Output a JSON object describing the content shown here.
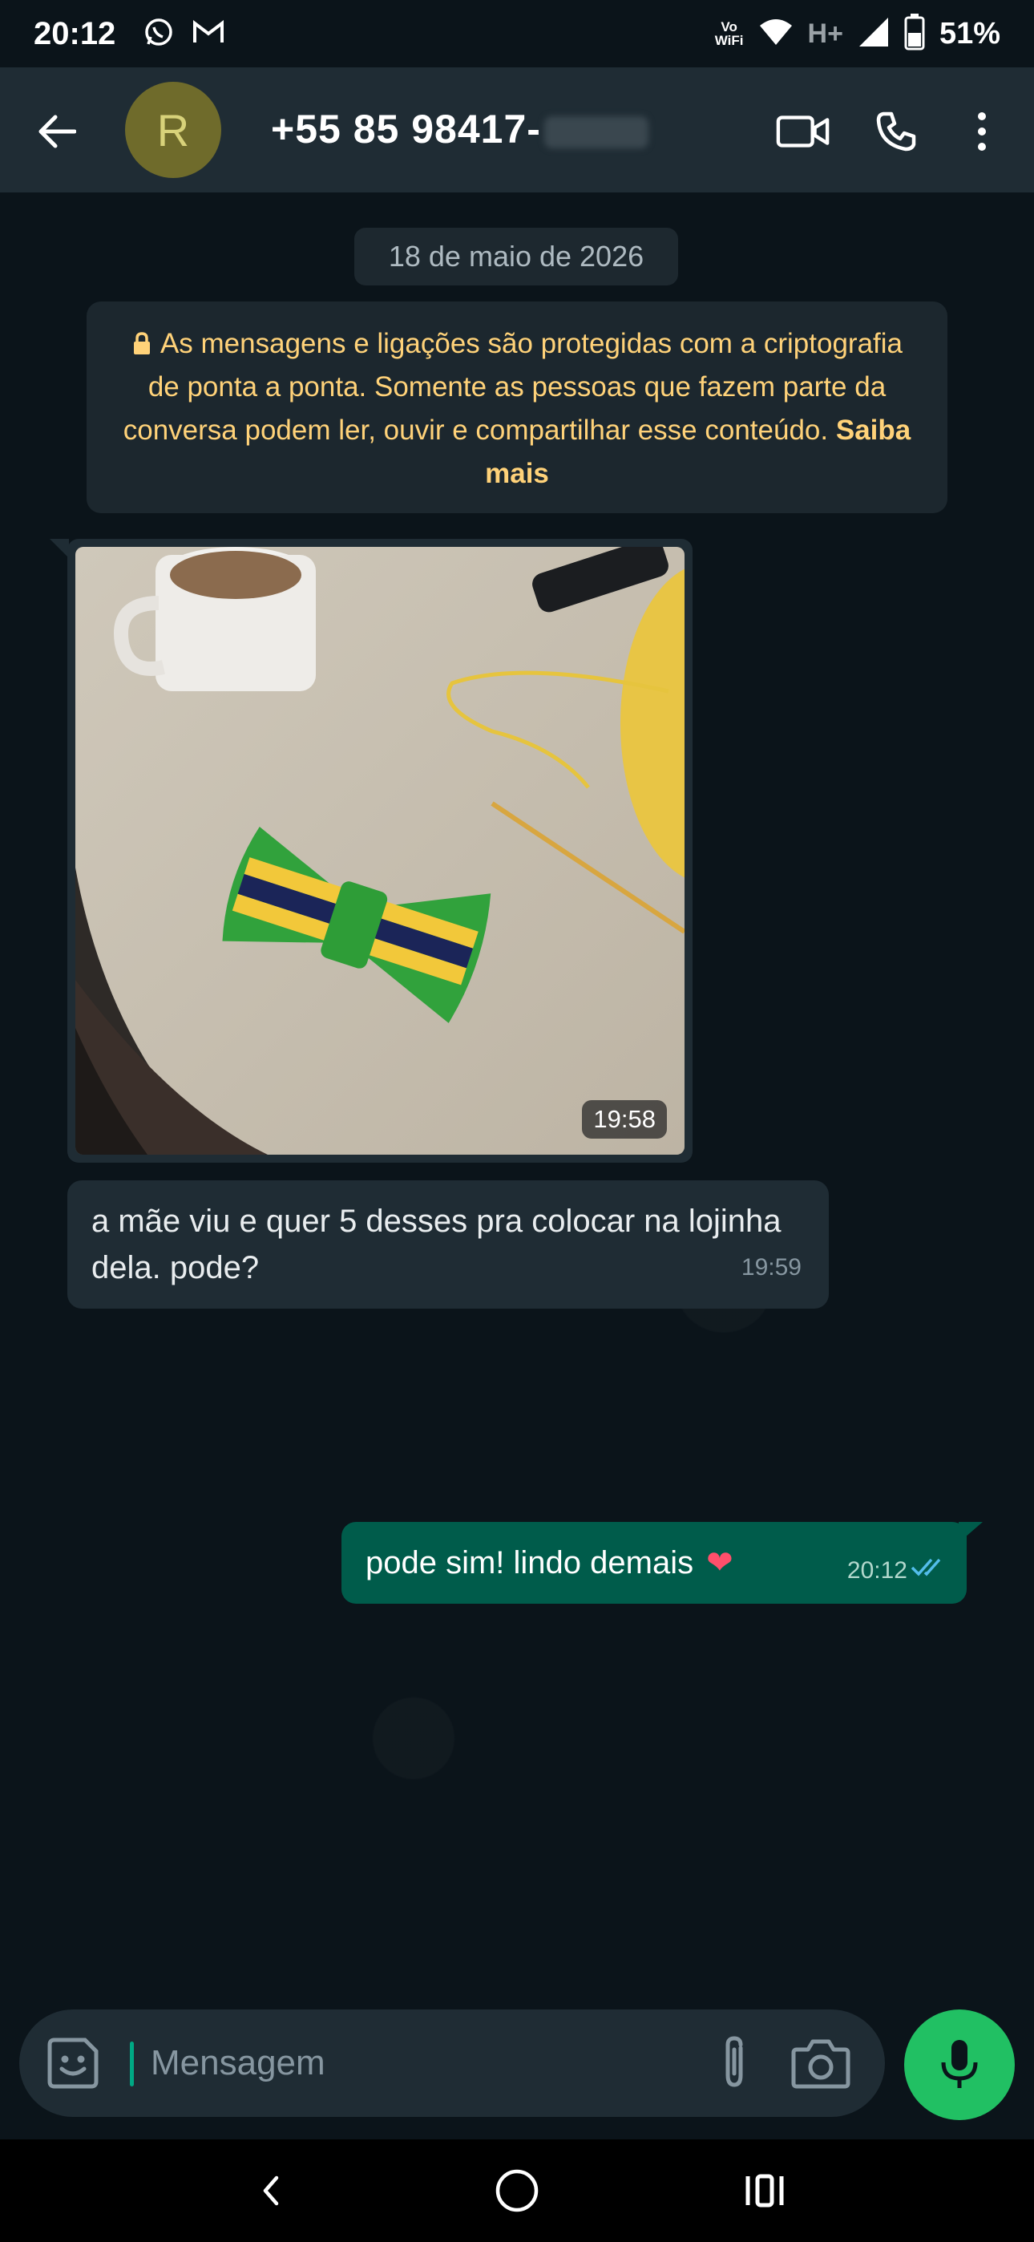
{
  "status_bar": {
    "time": "20:12",
    "left_icons": [
      "whatsapp-icon",
      "gmail-icon"
    ],
    "vowifi_line1": "Vo",
    "vowifi_line2": "WiFi",
    "network": "H+",
    "battery": "51%"
  },
  "header": {
    "avatar_letter": "R",
    "contact_name": "+55 85 98417-",
    "icons": [
      "back-arrow-icon",
      "video-call-icon",
      "voice-call-icon",
      "more-options-icon"
    ]
  },
  "chat": {
    "date_chip": "18 de maio de 2026",
    "encryption_notice": {
      "text": "As mensagens e ligações são protegidas com a criptografia de ponta a ponta. Somente as pessoas que fazem parte da conversa podem ler, ouvir e compartilhar esse conteúdo.",
      "link": "Saiba mais"
    },
    "messages": [
      {
        "type": "image",
        "direction": "in",
        "time": "19:58"
      },
      {
        "type": "text",
        "direction": "in",
        "text": "a mãe viu e quer 5 desses pra colocar na lojinha dela. pode?",
        "time": "19:59"
      },
      {
        "type": "text",
        "direction": "out",
        "text": "pode sim! lindo demais",
        "emoji": "❤",
        "time": "20:12",
        "status": "read"
      }
    ]
  },
  "composer": {
    "placeholder": "Mensagem",
    "value": ""
  },
  "colors": {
    "background": "#0b141a",
    "header": "#1f2c34",
    "incoming_bubble": "#1f2c34",
    "outgoing_bubble": "#005c4b",
    "accent": "#21c063",
    "notice_text": "#ffd279"
  }
}
